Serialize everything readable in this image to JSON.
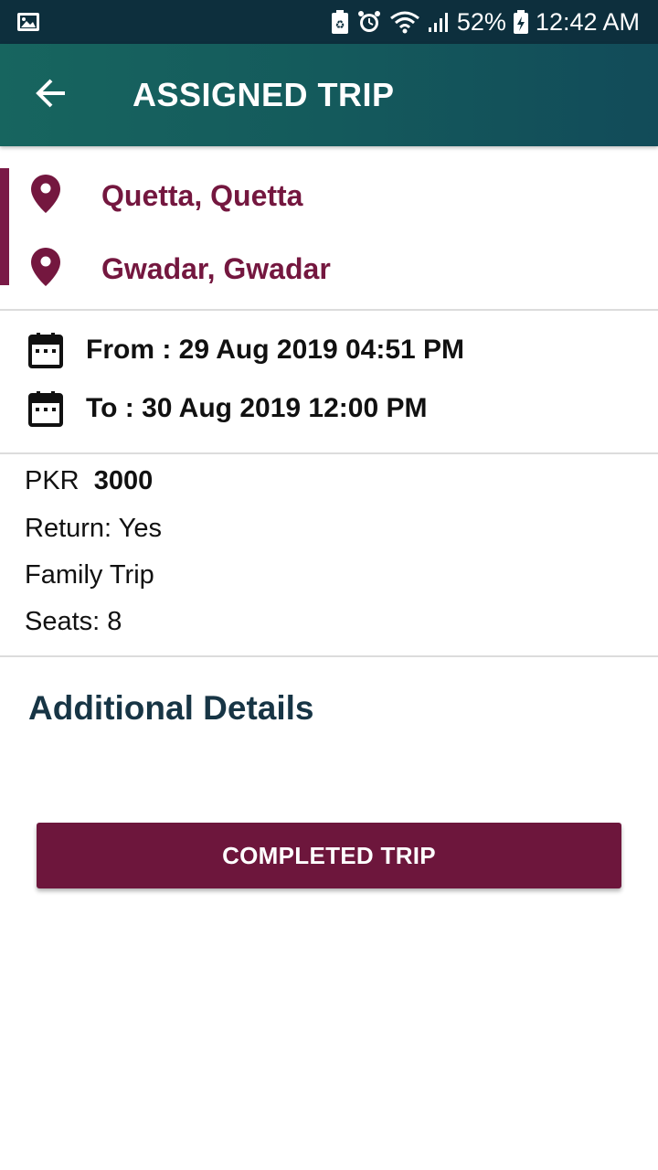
{
  "status_bar": {
    "battery_percent": "52%",
    "time": "12:42 AM",
    "icons": [
      "image-icon",
      "battery-saver-icon",
      "alarm-icon",
      "wifi-icon",
      "signal-icon",
      "battery-icon"
    ]
  },
  "app_bar": {
    "title": "ASSIGNED TRIP",
    "back_icon": "arrow-left-icon"
  },
  "route": {
    "origin": "Quetta, Quetta",
    "destination": "Gwadar, Gwadar",
    "pin_icon": "location-pin-icon"
  },
  "schedule": {
    "from_label": "From :",
    "from_value": "29 Aug 2019 04:51 PM",
    "to_label": "To :",
    "to_value": "30 Aug 2019 12:00 PM",
    "calendar_icon": "calendar-icon"
  },
  "details": {
    "currency": "PKR",
    "amount": "3000",
    "return": "Return: Yes",
    "trip_type": "Family Trip",
    "seats": "Seats: 8"
  },
  "additional": {
    "title": "Additional Details"
  },
  "actions": {
    "completed_label": "COMPLETED TRIP"
  },
  "colors": {
    "status_bar": "#0d2f3d",
    "app_bar": "#145a5c",
    "accent": "#74173f",
    "button": "#6d163c",
    "section_title": "#173545"
  }
}
